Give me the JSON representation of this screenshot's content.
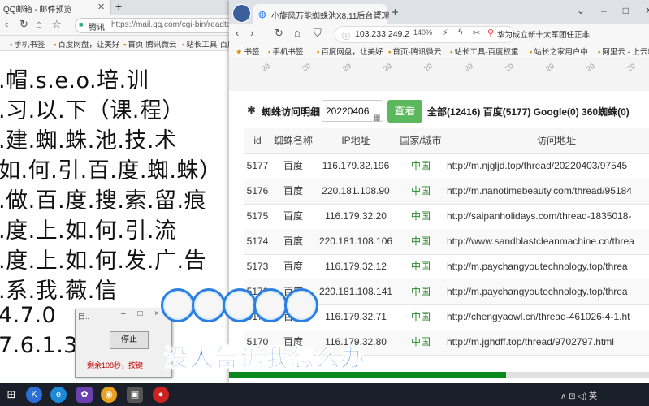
{
  "left_browser": {
    "tab_title": "QQ邮箱 - 邮件预览",
    "url_site": "腾讯",
    "url_text": "https://mail.qq.com/cgi-bin/readte",
    "bookmarks": [
      "手机书签",
      "百度网盘，让美好",
      "首页-腾讯微云",
      "站长工具-百度"
    ],
    "lines": [
      ".帽.s.e.o.培.训",
      ".习.以.下（课.程）",
      ".建.蜘.蛛.池.技.术",
      "如.何.引.百.度.蜘.蛛）",
      ".做.百.度.搜.索.留.痕",
      ".度.上.如.何.引.流",
      ".度.上.如.何.发.广.告",
      ".系.我.薇.信",
      "4.7.0",
      "7.6.1.3"
    ]
  },
  "dialog": {
    "title": "目..",
    "controls": "– □ ×",
    "stop_label": "停止",
    "message": "剩余108秒，按键"
  },
  "right_browser": {
    "tab_title": "小旋风万能蜘蛛池X8.11后台管理",
    "url_text": "103.233.249.2",
    "zoom": "140%",
    "news": "华为成立新十大军团任正非",
    "bookmarks": [
      "书签",
      "手机书签",
      "百度网盘，让美好",
      "首页-腾讯微云",
      "站长工具-百度权重",
      "站长之家用户中",
      "阿里云 - 上云就上"
    ],
    "blurred": [
      "20",
      "20",
      "20",
      "20",
      "20",
      "20",
      "20",
      "20",
      "20",
      "20"
    ],
    "filter_label": "蜘蛛访问明细",
    "date_value": "20220406",
    "query_label": "查看",
    "counts": "全部(12416)  百度(5177)  Google(0)  360蜘蛛(0)",
    "progress_fraction": 0.66
  },
  "table": {
    "headers": [
      "id",
      "蜘蛛名称",
      "IP地址",
      "国家/城市",
      "访问地址"
    ],
    "rows": [
      [
        "5177",
        "百度",
        "116.179.32.196",
        "中国",
        "http://m.njgljd.top/thread/20220403/97545"
      ],
      [
        "5176",
        "百度",
        "220.181.108.90",
        "中国",
        "http://m.nanotimebeauty.com/thread/95184"
      ],
      [
        "5175",
        "百度",
        "116.179.32.20",
        "中国",
        "http://saipanholidays.com/thread-1835018-"
      ],
      [
        "5174",
        "百度",
        "220.181.108.106",
        "中国",
        "http://www.sandblastcleanmachine.cn/threa"
      ],
      [
        "5173",
        "百度",
        "116.179.32.12",
        "中国",
        "http://m.paychangyoutechnology.top/threa"
      ],
      [
        "5172",
        "百度",
        "220.181.108.141",
        "中国",
        "http://m.paychangyoutechnology.top/threa"
      ],
      [
        "5171",
        "百度",
        "116.179.32.71",
        "中国",
        "http://chengyaowl.cn/thread-461026-4-1.ht"
      ],
      [
        "5170",
        "百度",
        "116.179.32.80",
        "中国",
        "http://m.jghdff.top/thread/9702797.html"
      ]
    ]
  },
  "caption": "没人告诉我怎么办",
  "taskbar": {
    "tray": "∧  ⊡  ◁)  英"
  }
}
